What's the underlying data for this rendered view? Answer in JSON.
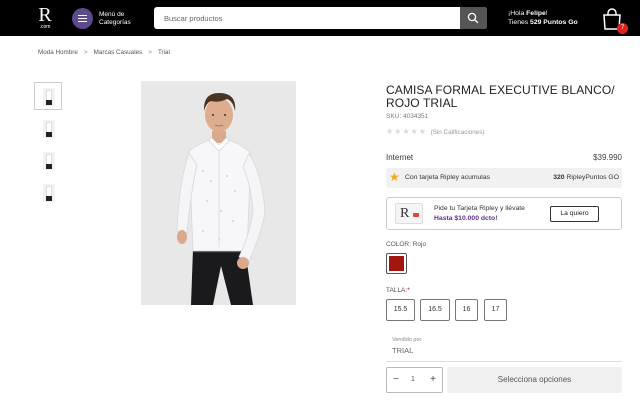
{
  "header": {
    "logo_letter": "R",
    "logo_suffix": ".com",
    "menu_line1": "Menú de",
    "menu_line2": "Categorías",
    "search_placeholder": "Buscar productos",
    "greeting_prefix": "¡Hola ",
    "user_name": "Felipe",
    "greeting_suffix": "!",
    "points_prefix": "Tienes ",
    "points_value": "529 Puntos Go",
    "cart_count": "7"
  },
  "breadcrumb": [
    "Moda Hombre",
    "Marcas Casuales",
    "Trial"
  ],
  "breadcrumb_separator": ">",
  "gallery": {
    "thumb_count": 4,
    "active_index": 0
  },
  "product": {
    "title": "CAMISA FORMAL EXECUTIVE BLANCO/ ROJO TRIAL",
    "sku_label": "SKU:",
    "sku": "4034351",
    "stars": "★★★★★",
    "rating_text": "(Sin Calificaciones)",
    "price_label": "Internet",
    "price": "$39.990",
    "points_label": "Con tarjeta Ripley acumulas",
    "points_value": "320",
    "points_unit": "RipleyPuntos GO",
    "card_promo_line1": "Pide tu Tarjeta Ripley y llévate",
    "card_promo_line2": "Hasta $10.000 dcto!",
    "card_button": "La quiero",
    "color_label": "COLOR:",
    "color_value": "Rojo",
    "color_hex": "#a3150f",
    "size_label": "TALLA:",
    "size_required_mark": "*",
    "sizes": [
      "15.5",
      "16.5",
      "16",
      "17"
    ],
    "seller_label": "Vendido por",
    "seller_name": "TRIAL",
    "quantity": "1",
    "minus_label": "−",
    "plus_label": "+",
    "select_button": "Selecciona opciones"
  },
  "colors": {
    "header_bg": "#000000",
    "menu_accent": "#5d4a8a",
    "cart_badge": "#e2231a",
    "promo_text": "#5d2f86",
    "star_points": "#f4a81d"
  }
}
